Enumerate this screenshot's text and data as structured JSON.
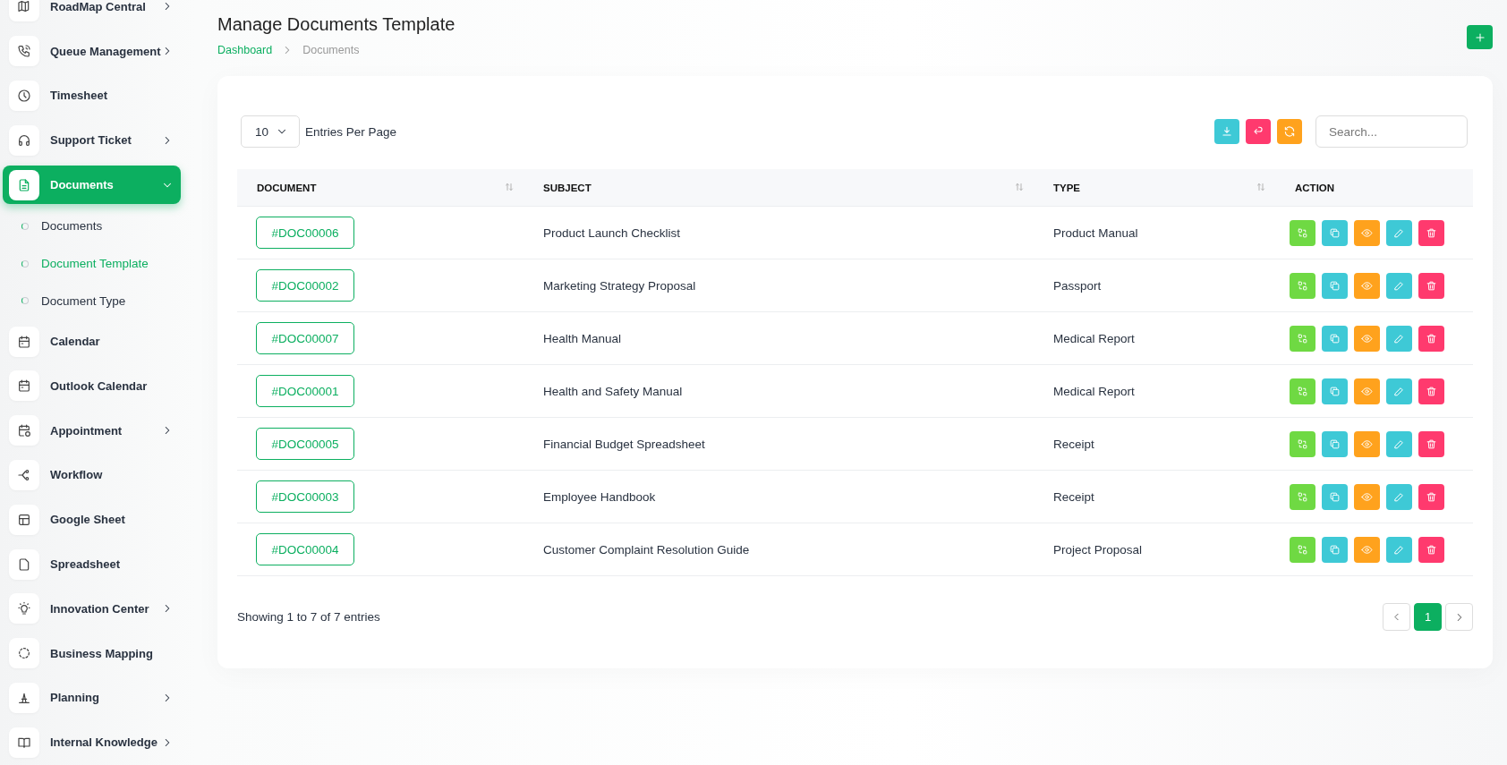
{
  "sidebar": {
    "items": [
      {
        "label": "RoadMap Central",
        "expandable": true,
        "selected": false
      },
      {
        "label": "Queue Management",
        "expandable": true,
        "selected": false
      },
      {
        "label": "Timesheet",
        "expandable": false,
        "selected": false
      },
      {
        "label": "Support Ticket",
        "expandable": true,
        "selected": false
      },
      {
        "label": "Documents",
        "expandable": true,
        "selected": true,
        "expanded": true,
        "children": [
          {
            "label": "Documents",
            "selected": false
          },
          {
            "label": "Document Template",
            "selected": true
          },
          {
            "label": "Document Type",
            "selected": false
          }
        ]
      },
      {
        "label": "Calendar",
        "expandable": false,
        "selected": false
      },
      {
        "label": "Outlook Calendar",
        "expandable": false,
        "selected": false
      },
      {
        "label": "Appointment",
        "expandable": true,
        "selected": false
      },
      {
        "label": "Workflow",
        "expandable": false,
        "selected": false
      },
      {
        "label": "Google Sheet",
        "expandable": false,
        "selected": false
      },
      {
        "label": "Spreadsheet",
        "expandable": false,
        "selected": false
      },
      {
        "label": "Innovation Center",
        "expandable": true,
        "selected": false
      },
      {
        "label": "Business Mapping",
        "expandable": false,
        "selected": false
      },
      {
        "label": "Planning",
        "expandable": true,
        "selected": false
      },
      {
        "label": "Internal Knowledge",
        "expandable": true,
        "selected": false
      }
    ]
  },
  "page": {
    "title": "Manage Documents Template",
    "breadcrumb": [
      "Dashboard",
      "Documents"
    ]
  },
  "toolbar": {
    "page_size": "10",
    "page_size_label": "Entries Per Page",
    "search": {
      "placeholder": "Search..."
    }
  },
  "table": {
    "columns": [
      {
        "label": "DOCUMENT",
        "sortable": true
      },
      {
        "label": "SUBJECT",
        "sortable": true
      },
      {
        "label": "TYPE",
        "sortable": true
      },
      {
        "label": "ACTION",
        "sortable": false
      }
    ],
    "rows": [
      {
        "document": "#DOC00006",
        "subject": "Product Launch Checklist",
        "type": "Product Manual"
      },
      {
        "document": "#DOC00002",
        "subject": "Marketing Strategy Proposal",
        "type": "Passport"
      },
      {
        "document": "#DOC00007",
        "subject": "Health Manual",
        "type": "Medical Report"
      },
      {
        "document": "#DOC00001",
        "subject": "Health and Safety Manual",
        "type": "Medical Report"
      },
      {
        "document": "#DOC00005",
        "subject": "Financial Budget Spreadsheet",
        "type": "Receipt"
      },
      {
        "document": "#DOC00003",
        "subject": "Employee Handbook",
        "type": "Receipt"
      },
      {
        "document": "#DOC00004",
        "subject": "Customer Complaint Resolution Guide",
        "type": "Project Proposal"
      }
    ]
  },
  "footer": {
    "summary": "Showing 1 to 7 of 7 entries",
    "pages": [
      {
        "label": "1",
        "selected": true
      }
    ]
  }
}
